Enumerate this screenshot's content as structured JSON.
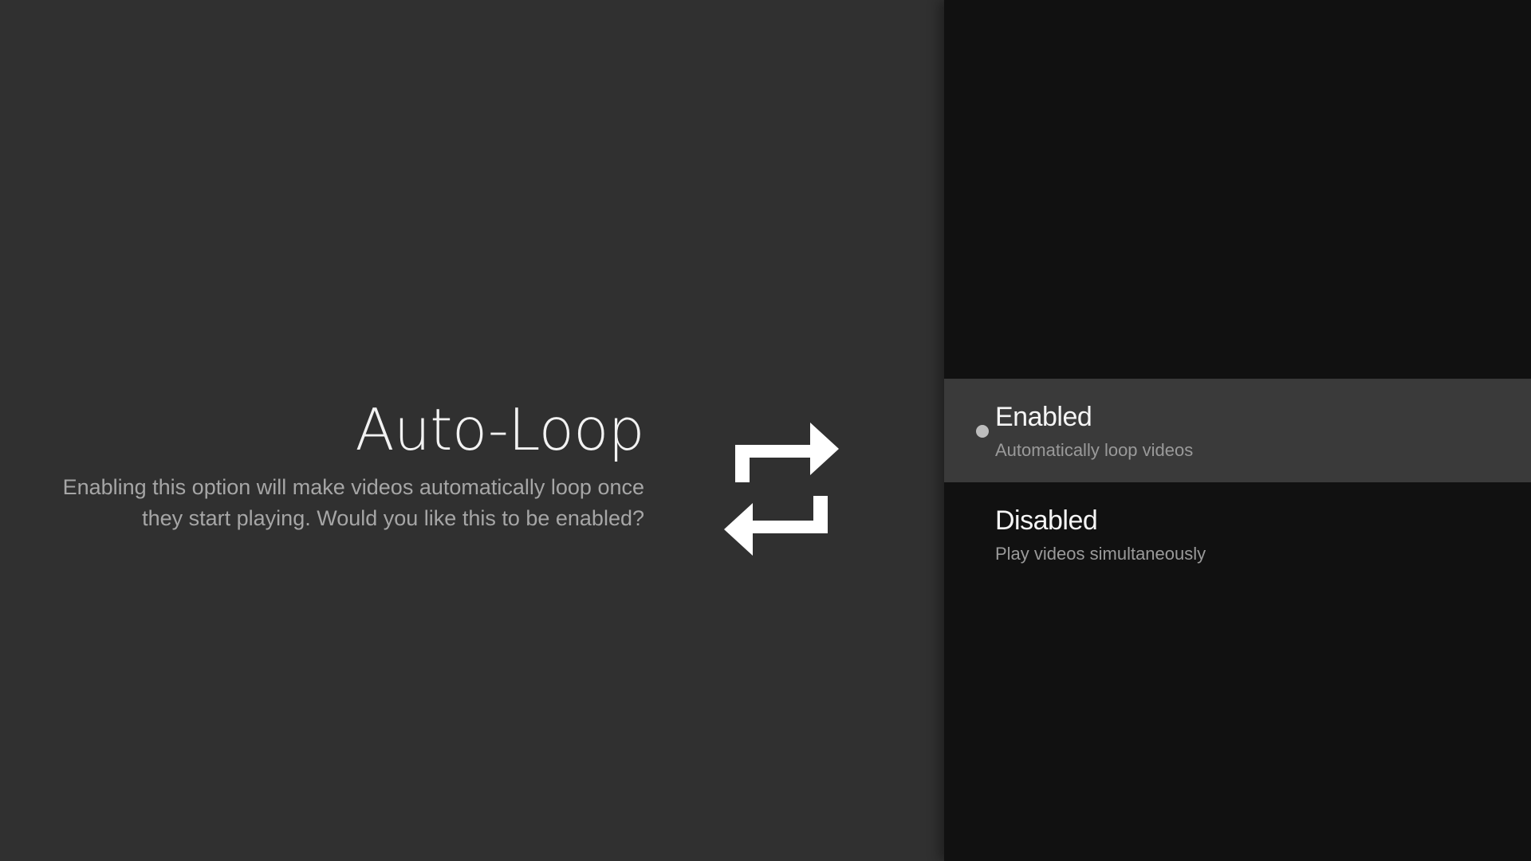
{
  "screen": {
    "title": "Auto-Loop",
    "description": "Enabling this option will make videos automatically loop once they start playing. Would you like this to be enabled?",
    "icon": "repeat-icon"
  },
  "options": [
    {
      "title": "Enabled",
      "subtitle": "Automatically loop videos",
      "selected": true
    },
    {
      "title": "Disabled",
      "subtitle": "Play videos simultaneously",
      "selected": false
    }
  ],
  "colors": {
    "left_background": "#303030",
    "right_background": "#111111",
    "selected_row": "#3a3a3a",
    "title_text": "#f2f2f2",
    "description_text": "#a6a6a6"
  }
}
